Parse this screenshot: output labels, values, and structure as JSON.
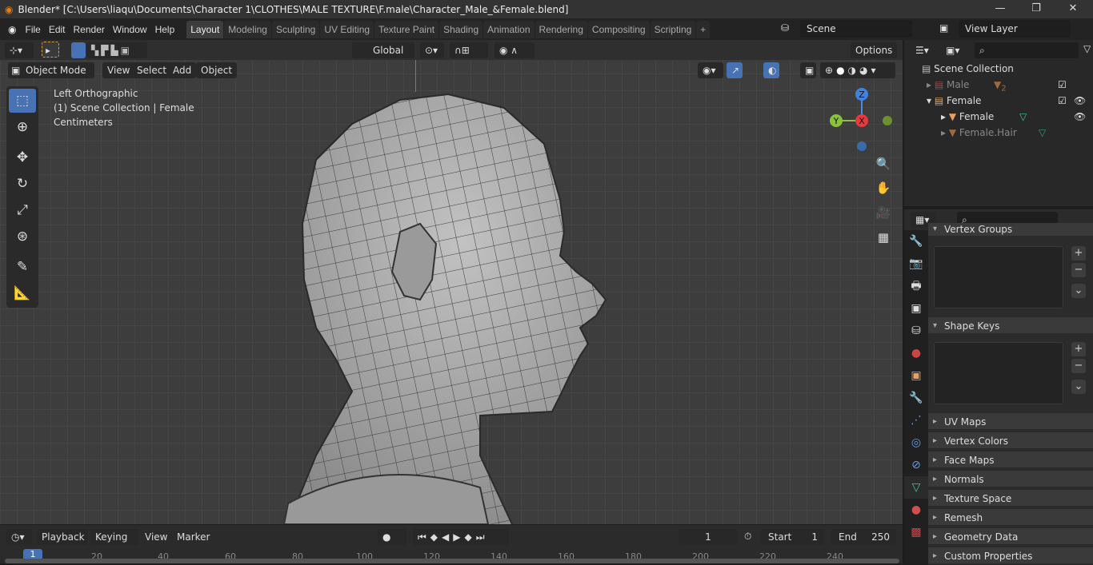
{
  "title": "Blender* [C:\\Users\\liaqu\\Documents\\Character 1\\CLOTHES\\MALE TEXTURE\\F.male\\Character_Male_&Female.blend]",
  "window": {
    "minimize": "—",
    "maximize": "❐",
    "close": "✕"
  },
  "menu": [
    "File",
    "Edit",
    "Render",
    "Window",
    "Help"
  ],
  "workspaces": [
    "Layout",
    "Modeling",
    "Sculpting",
    "UV Editing",
    "Texture Paint",
    "Shading",
    "Animation",
    "Rendering",
    "Compositing",
    "Scripting",
    "+"
  ],
  "scene": "Scene",
  "view_layer": "View Layer",
  "header": {
    "orientation": "Global",
    "options": "Options",
    "mode": "Object Mode",
    "menus": [
      "View",
      "Select",
      "Add",
      "Object"
    ]
  },
  "overlay_text": {
    "view": "Left Orthographic",
    "collection": "(1) Scene Collection | Female",
    "units": "Centimeters"
  },
  "gizmo": {
    "z": "Z",
    "y": "Y",
    "x": "X"
  },
  "outliner": {
    "root": "Scene Collection",
    "items": [
      {
        "label": "Male",
        "badge": "2"
      },
      {
        "label": "Female"
      },
      {
        "label": "Female"
      },
      {
        "label": "Female.Hair"
      }
    ]
  },
  "properties": {
    "panels": [
      "Vertex Groups",
      "Shape Keys",
      "UV Maps",
      "Vertex Colors",
      "Face Maps",
      "Normals",
      "Texture Space",
      "Remesh",
      "Geometry Data",
      "Custom Properties"
    ]
  },
  "timeline": {
    "menus": [
      "Playback",
      "Keying",
      "View",
      "Marker"
    ],
    "current_frame": "1",
    "start_label": "Start",
    "start": "1",
    "end_label": "End",
    "end": "250",
    "ticks": [
      "1",
      "20",
      "40",
      "60",
      "80",
      "100",
      "120",
      "140",
      "160",
      "180",
      "200",
      "220",
      "240"
    ]
  },
  "colors": {
    "accent": "#4772b3",
    "orange": "#e87d0d"
  }
}
